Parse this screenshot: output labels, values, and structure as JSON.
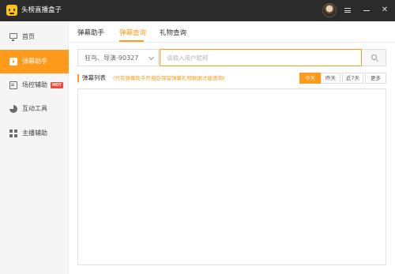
{
  "app": {
    "title": "头榜直播盒子"
  },
  "sidebar": {
    "items": [
      {
        "label": "首页",
        "icon": "monitor-icon"
      },
      {
        "label": "弹幕助手",
        "icon": "video-icon",
        "active": true
      },
      {
        "label": "场控辅助",
        "icon": "document-icon",
        "badge": "HOT"
      },
      {
        "label": "互动工具",
        "icon": "pie-chart-icon"
      },
      {
        "label": "主播辅助",
        "icon": "grid-icon"
      }
    ]
  },
  "tabs": [
    {
      "label": "弹幕助手"
    },
    {
      "label": "弹幕查询",
      "active": true
    },
    {
      "label": "礼物查询"
    }
  ],
  "filter": {
    "room_select": "狂鸟、导演-90327",
    "search_placeholder": "请输入用户昵称"
  },
  "section": {
    "title": "弹幕列表",
    "hint": "(只有弹幕助手开启后保留弹幕礼物数据才能查询)"
  },
  "time_filters": [
    {
      "label": "今天",
      "active": true
    },
    {
      "label": "昨天"
    },
    {
      "label": "近7天"
    },
    {
      "label": "更多"
    }
  ],
  "colors": {
    "accent": "#ff9a1a",
    "titlebar": "#2b2b2b",
    "sidebar_bg": "#f5f5f5",
    "hot_badge": "#f04a3a"
  }
}
